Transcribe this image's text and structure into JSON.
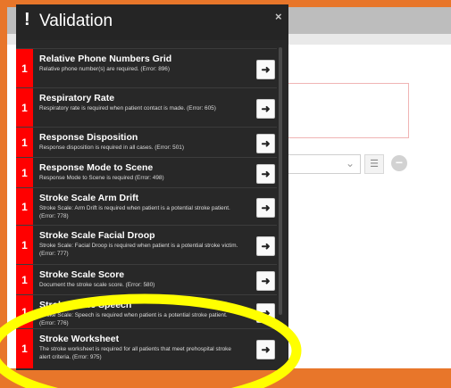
{
  "dialog": {
    "icon": "exclamation-icon",
    "title": "Validation",
    "close_glyph": "×",
    "go_glyph": "➜",
    "items": [
      {
        "count": "1",
        "title": "Relative Phone Numbers Grid",
        "desc": "Relative phone number(s) are required. (Error: 896)"
      },
      {
        "count": "1",
        "title": "Respiratory Rate",
        "desc": "Respiratory rate is required when patient contact is made. (Error: 605)"
      },
      {
        "count": "1",
        "title": "Response Disposition",
        "desc": "Response disposition is required in all cases. (Error: 501)"
      },
      {
        "count": "1",
        "title": "Response Mode to Scene",
        "desc": "Response Mode to Scene is required (Error: 498)"
      },
      {
        "count": "1",
        "title": "Stroke Scale Arm Drift",
        "desc": "Stroke Scale: Arm Drift is required when patient is a potential stroke patient. (Error: 778)"
      },
      {
        "count": "1",
        "title": "Stroke Scale Facial Droop",
        "desc": "Stroke Scale: Facial Droop is required when patient is a potential stroke victim. (Error: 777)"
      },
      {
        "count": "1",
        "title": "Stroke Scale Score",
        "desc": "Document the stroke scale score. (Error: 580)"
      },
      {
        "count": "1",
        "title": "Stroke Scale Speech",
        "desc": "Stroke Scale: Speech is required when patient is a potential stroke patient. (Error: 776)"
      },
      {
        "count": "1",
        "title": "Stroke Worksheet",
        "desc": "The stroke worksheet is required for all patients that meet prehospital stroke alert criteria. (Error: 975)"
      }
    ]
  },
  "background": {
    "dropdown_chevron": "⌄",
    "list_glyph": "☰",
    "remove_glyph": "−"
  },
  "annotation": {
    "ring_color": "#ffff00"
  },
  "colors": {
    "badge": "#ff0000",
    "panel": "#282828",
    "frame": "#e8762a"
  }
}
